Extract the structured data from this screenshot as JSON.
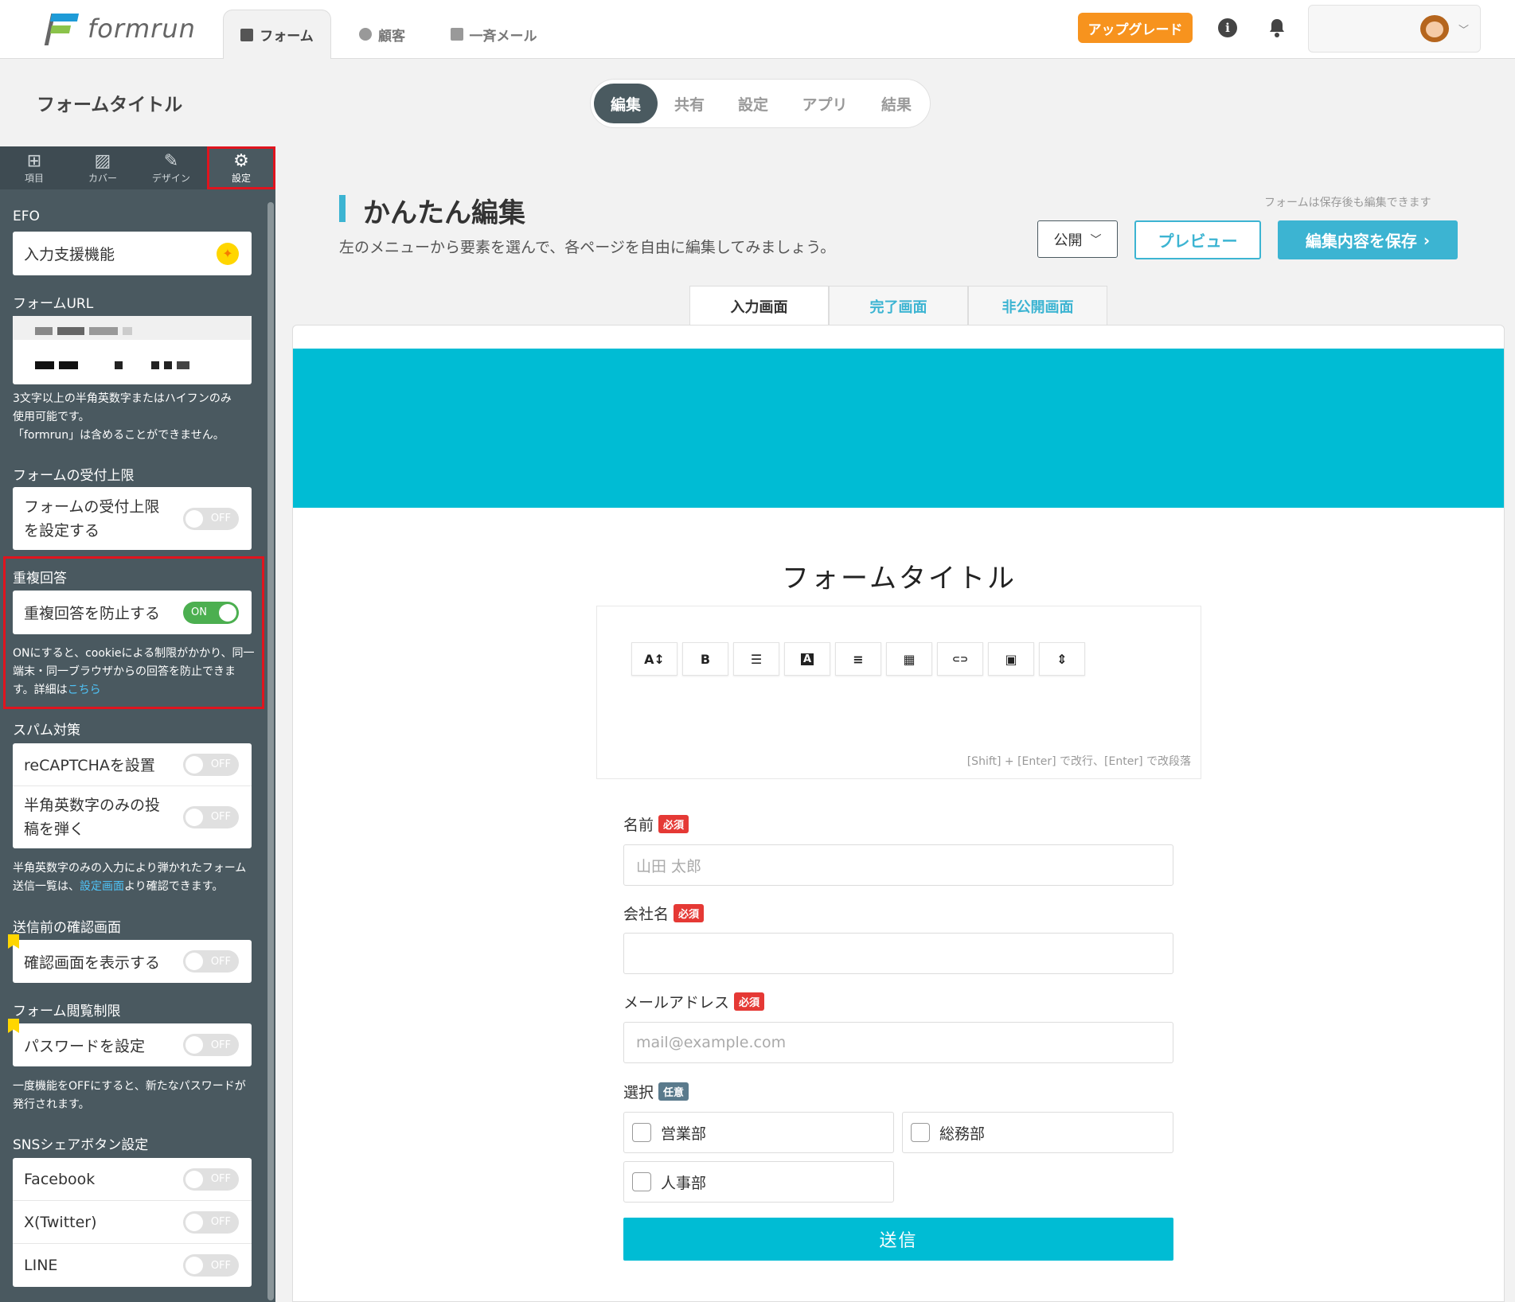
{
  "header": {
    "logo_text": "formrun",
    "tabs": [
      {
        "label": "フォーム",
        "icon": "document-icon"
      },
      {
        "label": "顧客",
        "icon": "people-icon"
      },
      {
        "label": "一斉メール",
        "icon": "mail-icon"
      }
    ],
    "upgrade_label": "アップグレード",
    "info_glyph": "i"
  },
  "page_title": "フォームタイトル",
  "segment_tabs": [
    "編集",
    "共有",
    "設定",
    "アプリ",
    "結果"
  ],
  "sidebar": {
    "tabs": [
      {
        "label": "項目",
        "icon": "plus-square-icon",
        "glyph": "⊞"
      },
      {
        "label": "カバー",
        "icon": "image-icon",
        "glyph": "▨"
      },
      {
        "label": "デザイン",
        "icon": "magic-wand-icon",
        "glyph": "✎"
      },
      {
        "label": "設定",
        "icon": "gear-icon",
        "glyph": "⚙"
      }
    ],
    "efo": {
      "title": "EFO",
      "row": "入力支援機能"
    },
    "form_url": {
      "title": "フォームURL",
      "help": [
        "3文字以上の半角英数字またはハイフンのみ",
        "使用可能です。",
        "「formrun」は含めることができません。"
      ]
    },
    "limit": {
      "title": "フォームの受付上限",
      "row": "フォームの受付上限を設定する",
      "toggle": "OFF"
    },
    "duplicate": {
      "title": "重複回答",
      "row": "重複回答を防止する",
      "toggle": "ON",
      "help": "ONにすると、cookieによる制限がかかり、同一端末・同一ブラウザからの回答を防止できます。詳細は",
      "link": "こちら"
    },
    "spam": {
      "title": "スパム対策",
      "rows": [
        {
          "label": "reCAPTCHAを設置",
          "toggle": "OFF"
        },
        {
          "label": "半角英数字のみの投稿を弾く",
          "toggle": "OFF"
        }
      ],
      "help_before": "半角英数字のみの入力により弾かれたフォーム送信一覧は、",
      "help_link": "設定画面",
      "help_after": "より確認できます。"
    },
    "confirm": {
      "title": "送信前の確認画面",
      "row": "確認画面を表示する",
      "toggle": "OFF"
    },
    "view_limit": {
      "title": "フォーム閲覧制限",
      "row": "パスワードを設定",
      "toggle": "OFF",
      "help": "一度機能をOFFにすると、新たなパスワードが発行されます。"
    },
    "sns": {
      "title": "SNSシェアボタン設定",
      "rows": [
        {
          "label": "Facebook",
          "toggle": "OFF"
        },
        {
          "label": "X(Twitter)",
          "toggle": "OFF"
        },
        {
          "label": "LINE",
          "toggle": "OFF"
        }
      ]
    }
  },
  "editor": {
    "title": "かんたん編集",
    "description": "左のメニューから要素を選んで、各ページを自由に編集してみましょう。",
    "save_note": "フォームは保存後も編集できます",
    "publish_select": "公開",
    "preview_label": "プレビュー",
    "save_label": "編集内容を保存",
    "screen_tabs": [
      "入力画面",
      "完了画面",
      "非公開画面"
    ]
  },
  "form": {
    "title": "フォームタイトル",
    "toolbar": [
      {
        "glyph": "A↕",
        "icon": "font-size-icon"
      },
      {
        "glyph": "B",
        "icon": "bold-icon"
      },
      {
        "glyph": "☰",
        "icon": "list-icon"
      },
      {
        "glyph": "A",
        "icon": "text-color-icon"
      },
      {
        "glyph": "≡",
        "icon": "align-icon"
      },
      {
        "glyph": "▦",
        "icon": "table-icon"
      },
      {
        "glyph": "⊂⊃",
        "icon": "link-icon"
      },
      {
        "glyph": "▣",
        "icon": "image-icon"
      },
      {
        "glyph": "⇕",
        "icon": "divider-icon"
      }
    ],
    "editor_hint": "[Shift] + [Enter] で改行、[Enter] で改段落",
    "fields": [
      {
        "label": "名前",
        "badge": "必須",
        "placeholder": "山田 太郎"
      },
      {
        "label": "会社名",
        "badge": "必須",
        "placeholder": ""
      },
      {
        "label": "メールアドレス",
        "badge": "必須",
        "placeholder": "mail@example.com"
      }
    ],
    "select": {
      "label": "選択",
      "badge": "任意",
      "options": [
        "営業部",
        "総務部",
        "人事部"
      ]
    },
    "submit_label": "送信"
  }
}
